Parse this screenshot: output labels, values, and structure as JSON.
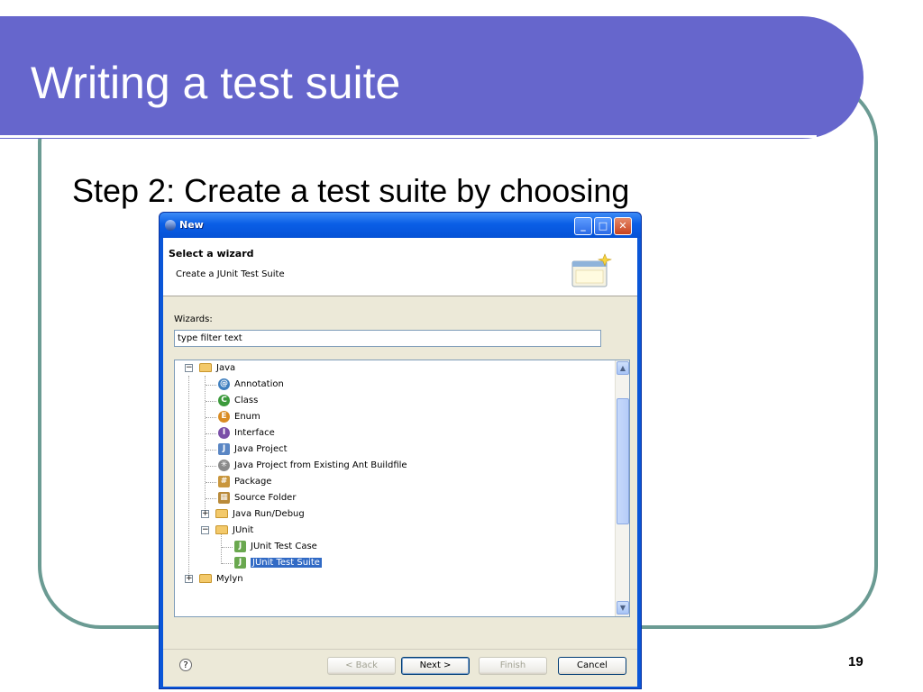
{
  "slide": {
    "title": "Writing a test suite",
    "step_text": "Step 2: Create a test suite by choosing",
    "page_number": "19"
  },
  "dialog": {
    "title": "New",
    "header_title": "Select a wizard",
    "header_description": "Create a JUnit Test Suite",
    "wizards_label": "Wizards:",
    "filter_value": "type filter text",
    "tree": {
      "java": "Java",
      "annotation": "Annotation",
      "class": "Class",
      "enum": "Enum",
      "interface": "Interface",
      "java_project": "Java Project",
      "java_project_ant": "Java Project from Existing Ant Buildfile",
      "package": "Package",
      "source_folder": "Source Folder",
      "java_run_debug": "Java Run/Debug",
      "junit": "JUnit",
      "junit_test_case": "JUnit Test Case",
      "junit_test_suite": "JUnit Test Suite",
      "mylyn": "Mylyn"
    },
    "selected_item": "JUnit Test Suite",
    "buttons": {
      "help": "?",
      "back": "< Back",
      "next": "Next >",
      "finish": "Finish",
      "cancel": "Cancel"
    }
  }
}
